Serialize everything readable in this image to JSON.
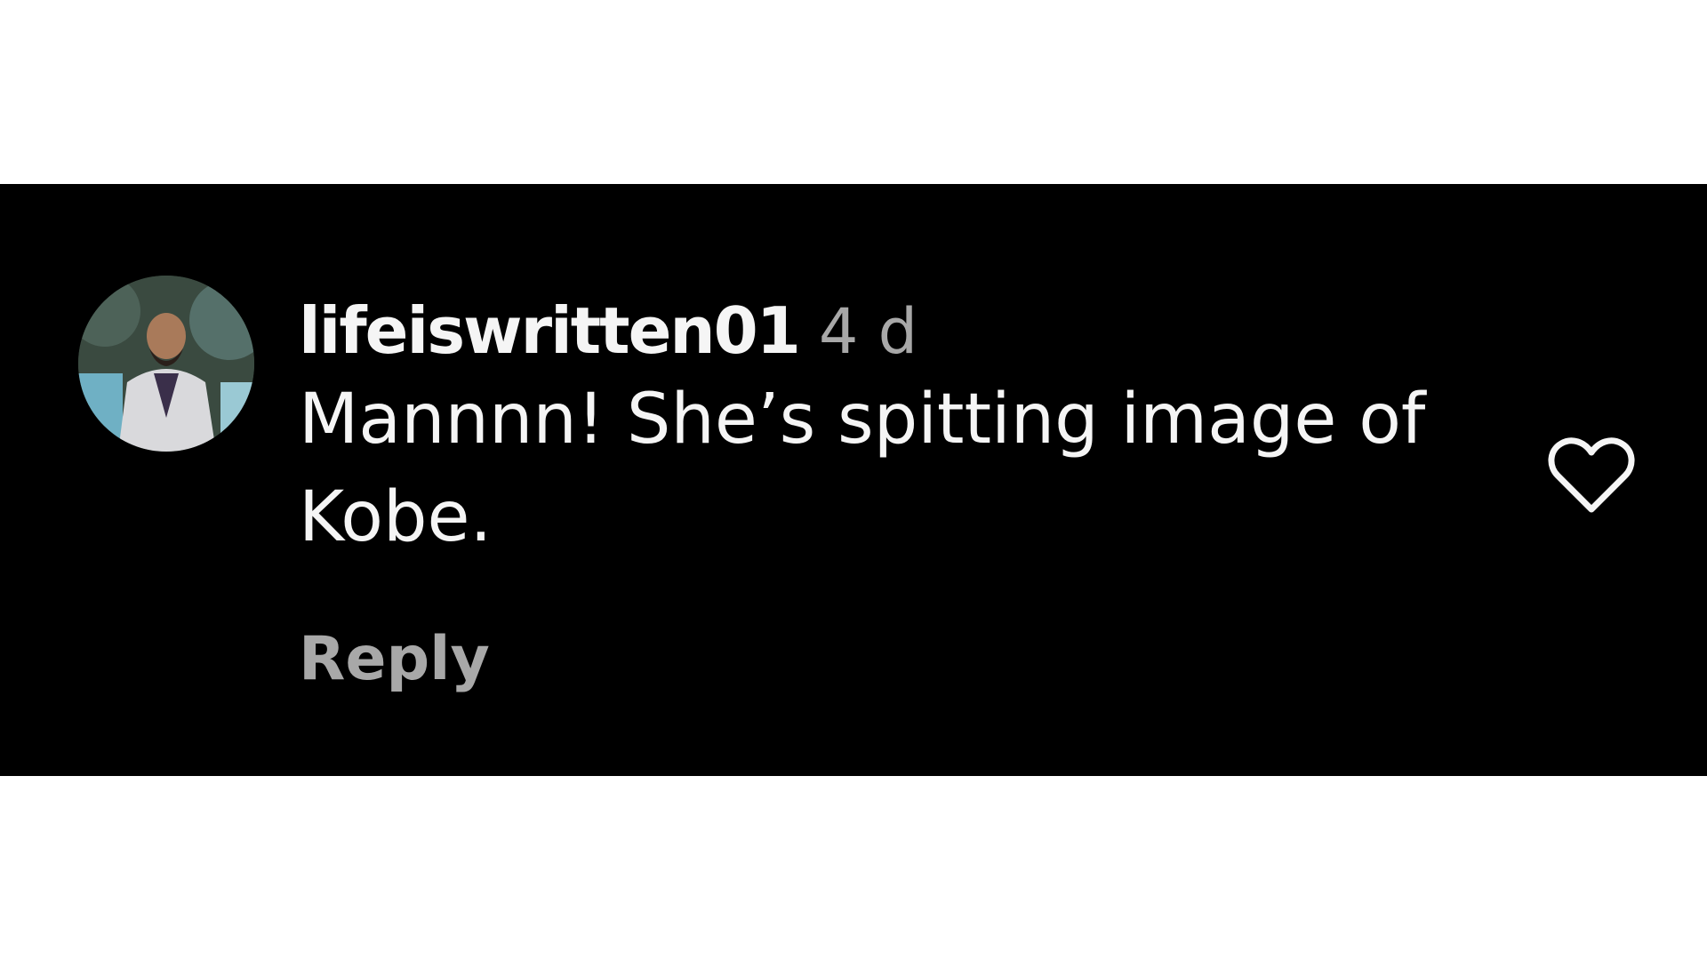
{
  "comment": {
    "username": "lifeiswritten01",
    "timestamp": "4 d",
    "text": "Mannnn! She’s spitting image of Kobe.",
    "reply_label": "Reply",
    "avatar_icon": "user-avatar",
    "like_icon": "heart-outline-icon"
  },
  "colors": {
    "panel_background": "#000000",
    "page_background": "#ffffff",
    "primary_text": "#f5f5f5",
    "secondary_text": "#a8a8a8"
  }
}
